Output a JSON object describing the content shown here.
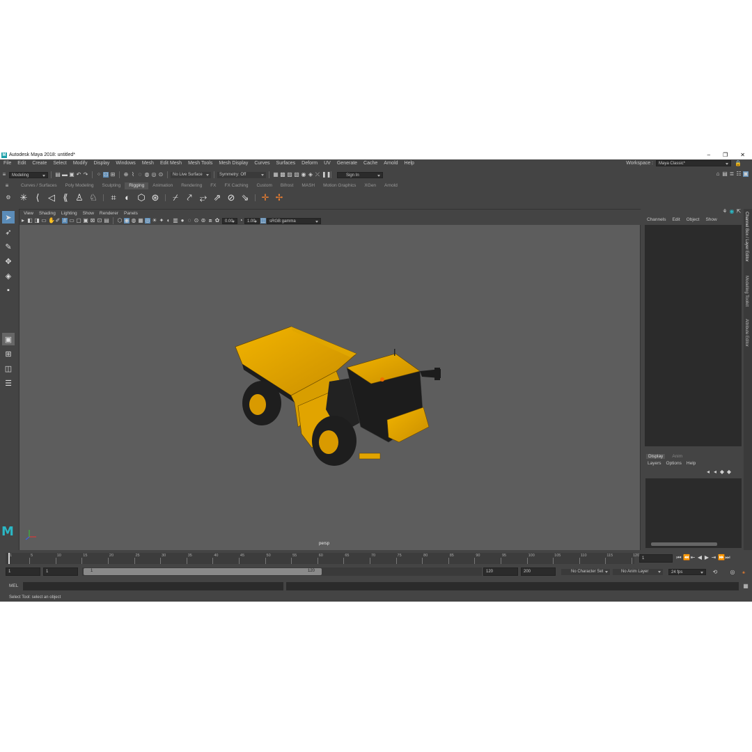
{
  "window": {
    "title": "Autodesk Maya 2018: untitled*",
    "logo": "M",
    "min": "–",
    "max": "❐",
    "close": "✕"
  },
  "menubar": {
    "items": [
      "File",
      "Edit",
      "Create",
      "Select",
      "Modify",
      "Display",
      "Windows",
      "Mesh",
      "Edit Mesh",
      "Mesh Tools",
      "Mesh Display",
      "Curves",
      "Surfaces",
      "Deform",
      "UV",
      "Generate",
      "Cache",
      "Arnold",
      "Help"
    ],
    "workspace_label": "Workspace :",
    "workspace_value": "Maya Classic*"
  },
  "statusline": {
    "menuset": "Modeling",
    "live_surface": "No Live Surface",
    "symmetry": "Symmetry: Off",
    "sign_in": "Sign In"
  },
  "shelf": {
    "tabs": [
      "Curves / Surfaces",
      "Poly Modeling",
      "Sculpting",
      "Rigging",
      "Animation",
      "Rendering",
      "FX",
      "FX Caching",
      "Custom",
      "Bifrost",
      "MASH",
      "Motion Graphics",
      "XGen",
      "Arnold"
    ],
    "active_tab": "Rigging"
  },
  "viewport": {
    "menu": [
      "View",
      "Shading",
      "Lighting",
      "Show",
      "Renderer",
      "Panels"
    ],
    "exposure": "0.00",
    "gamma": "1.00",
    "color_space": "sRGB gamma",
    "camera": "persp",
    "model_colors": {
      "body": "#f2a900",
      "dark": "#1c1c1c",
      "tire": "#1e1e1e",
      "hub": "#d99a00"
    }
  },
  "channelbox": {
    "menu": [
      "Channels",
      "Edit",
      "Object",
      "Show"
    ],
    "layer_tabs": [
      "Display",
      "Anim"
    ],
    "layer_menu": [
      "Layers",
      "Options",
      "Help"
    ],
    "side_tabs": [
      "Channel Box / Layer Editor",
      "Modelling Toolkit",
      "Attribute Editor"
    ]
  },
  "timeslider": {
    "ticks": [
      1,
      5,
      10,
      15,
      20,
      25,
      30,
      35,
      40,
      45,
      50,
      55,
      60,
      65,
      70,
      75,
      80,
      85,
      90,
      95,
      100,
      105,
      110,
      115,
      120
    ],
    "current_frame": "1"
  },
  "rangeslider": {
    "start": "1",
    "range_start": "1",
    "bar_start": "1",
    "bar_end": "120",
    "range_end": "120",
    "end": "200",
    "character_set": "No Character Set",
    "anim_layer": "No Anim Layer",
    "fps": "24 fps"
  },
  "cmdline": {
    "lang": "MEL"
  },
  "helpline": {
    "text": "Select Tool: select an object"
  }
}
